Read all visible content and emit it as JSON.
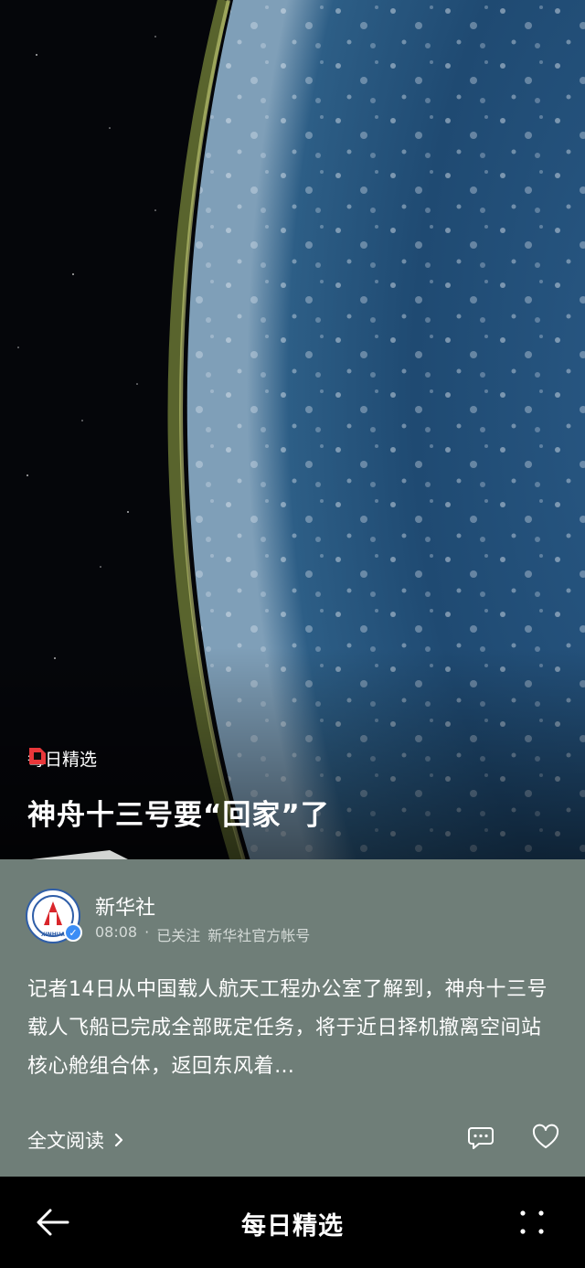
{
  "hero": {
    "section_label": "每日精选",
    "title": "神舟十三号要“回家”了"
  },
  "post": {
    "author": "新华社",
    "time": "08:08",
    "separator": "·",
    "follow_status": "已关注",
    "account_type": "新华社官方帐号",
    "body": "记者14日从中国载人航天工程办公室了解到，神舟十三号载人飞船已完成全部既定任务，将于近日择机撤离空间站核心舱组合体，返回东风着…",
    "read_more": "全文阅读",
    "avatar_text": "XINHUA"
  },
  "navbar": {
    "title": "每日精选"
  },
  "colors": {
    "card_bg": "#6f7e78",
    "brand_red": "#e8373a",
    "avatar_border": "#2f5ea8",
    "verified_blue": "#3b8df5"
  },
  "icons": [
    "daily-pick-logo-icon",
    "verified-icon",
    "chevron-right-icon",
    "comment-icon",
    "heart-icon",
    "back-arrow-icon",
    "more-dots-icon"
  ]
}
